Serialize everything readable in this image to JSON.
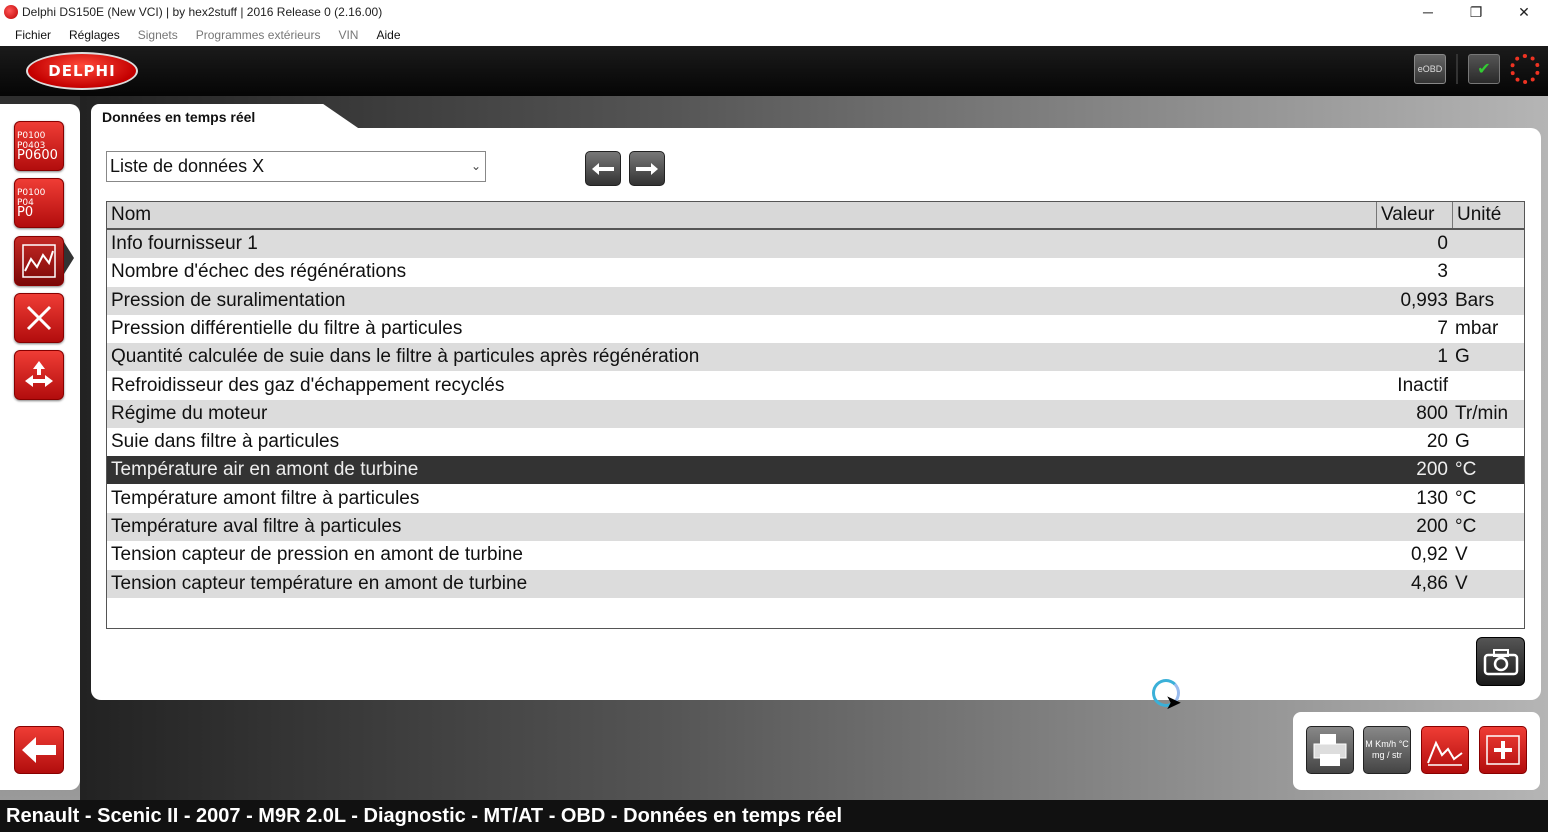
{
  "window": {
    "title": "Delphi DS150E (New VCI) | by hex2stuff | 2016 Release 0 (2.16.00)",
    "minimize": "─",
    "maximize": "❐",
    "close": "✕"
  },
  "menu": [
    {
      "label": "Fichier",
      "enabled": true
    },
    {
      "label": "Réglages",
      "enabled": true
    },
    {
      "label": "Signets",
      "enabled": false
    },
    {
      "label": "Programmes extérieurs",
      "enabled": false
    },
    {
      "label": "VIN",
      "enabled": false
    },
    {
      "label": "Aide",
      "enabled": true
    }
  ],
  "header": {
    "logo": "DELPHI",
    "eobd_label": "eOBD"
  },
  "sidebar": {
    "dtc_read": {
      "line1": "P0100",
      "line2": "P0403",
      "line3": "P0600"
    },
    "dtc_clear": {
      "line1": "P0100",
      "line2": "P04",
      "line3": "P0"
    }
  },
  "tab": {
    "label": "Données en temps réel"
  },
  "dropdown": {
    "value": "Liste de données X"
  },
  "table": {
    "headers": {
      "name": "Nom",
      "value": "Valeur",
      "unit": "Unité"
    },
    "rows": [
      {
        "name": "Info fournisseur 1",
        "value": "0",
        "unit": ""
      },
      {
        "name": "Nombre d'échec des régénérations",
        "value": "3",
        "unit": ""
      },
      {
        "name": "Pression de suralimentation",
        "value": "0,993",
        "unit": "Bars"
      },
      {
        "name": "Pression différentielle du filtre à particules",
        "value": "7",
        "unit": "mbar"
      },
      {
        "name": "Quantité calculée de suie dans le filtre à particules après régénération",
        "value": "1",
        "unit": "G"
      },
      {
        "name": "Refroidisseur des gaz d'échappement recyclés",
        "value": "Inactif",
        "unit": ""
      },
      {
        "name": "Régime du moteur",
        "value": "800",
        "unit": "Tr/min"
      },
      {
        "name": "Suie dans filtre à particules",
        "value": "20",
        "unit": "G"
      },
      {
        "name": "Température air en amont de turbine",
        "value": "200",
        "unit": "°C"
      },
      {
        "name": "Température amont filtre à particules",
        "value": "130",
        "unit": "°C"
      },
      {
        "name": "Température aval filtre à particules",
        "value": "200",
        "unit": "°C"
      },
      {
        "name": "Tension capteur de pression en amont de turbine",
        "value": "0,92",
        "unit": "V"
      },
      {
        "name": "Tension capteur température en amont de turbine",
        "value": "4,86",
        "unit": "V"
      }
    ],
    "selected_index": 8
  },
  "tools": {
    "graph_labels": "M Km/h °C mg / str"
  },
  "status": {
    "text": "Renault - Scenic II - 2007 - M9R 2.0L - Diagnostic - MT/AT - OBD - Données en temps réel"
  },
  "colors": {
    "accent": "#d81e1e",
    "selected_row": "#333333"
  }
}
